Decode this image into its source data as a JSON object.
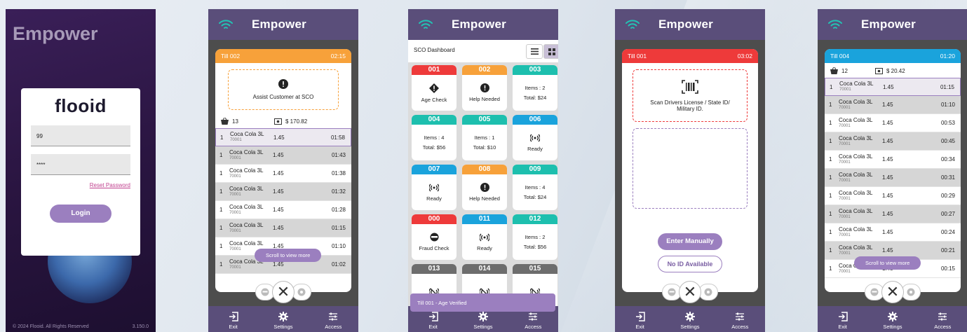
{
  "login": {
    "app_title": "Empower",
    "brand": "flooid",
    "username": "99",
    "password": "****",
    "reset": "Reset Password",
    "login": "Login",
    "copyright": "© 2024 Flooid. All Rights Reserved",
    "version": "3.150.0"
  },
  "app_title": "Empower",
  "nav": {
    "exit": "Exit",
    "settings": "Settings",
    "access": "Access"
  },
  "scroll_more": "Scroll to view more",
  "colors": {
    "purple": "#5a4e7a",
    "orange": "#f7a13a",
    "red": "#ee3a3a",
    "teal": "#1dbfae",
    "blue": "#1aa3dc",
    "gray": "#6d6d6d",
    "accent": "#9b7fbf"
  },
  "s2": {
    "till": "Till 002",
    "time": "02:15",
    "alert": "Assist Customer at SCO",
    "items": "13",
    "amount": "$ 170.82",
    "rows": [
      {
        "q": "1",
        "name": "Coca Cola 3L",
        "code": "70001",
        "price": "1.45",
        "time": "01:58"
      },
      {
        "q": "1",
        "name": "Coca Cola 3L",
        "code": "70001",
        "price": "1.45",
        "time": "01:43"
      },
      {
        "q": "1",
        "name": "Coca Cola 3L",
        "code": "70001",
        "price": "1.45",
        "time": "01:38"
      },
      {
        "q": "1",
        "name": "Coca Cola 3L",
        "code": "70001",
        "price": "1.45",
        "time": "01:32"
      },
      {
        "q": "1",
        "name": "Coca Cola 3L",
        "code": "70001",
        "price": "1.45",
        "time": "01:28"
      },
      {
        "q": "1",
        "name": "Coca Cola 3L",
        "code": "70001",
        "price": "1.45",
        "time": "01:15"
      },
      {
        "q": "1",
        "name": "Coca Cola 3L",
        "code": "70001",
        "price": "1.45",
        "time": "01:10"
      },
      {
        "q": "1",
        "name": "Coca Cola 3L",
        "code": "70001",
        "price": "1.45",
        "time": "01:02"
      }
    ]
  },
  "s3": {
    "title": "SCO Dashboard",
    "banner": "Till 001  - Age Verified",
    "tiles": [
      {
        "id": "001",
        "color": "red",
        "l1": "Age Check",
        "l2": "",
        "icon": "age"
      },
      {
        "id": "002",
        "color": "orange",
        "l1": "Help Needed",
        "l2": "",
        "icon": "alert"
      },
      {
        "id": "003",
        "color": "teal",
        "l1": "Items : 2",
        "l2": "Total: $24",
        "icon": ""
      },
      {
        "id": "004",
        "color": "teal",
        "l1": "Items : 4",
        "l2": "Total: $56",
        "icon": ""
      },
      {
        "id": "005",
        "color": "teal",
        "l1": "Items : 1",
        "l2": "Total: $10",
        "icon": ""
      },
      {
        "id": "006",
        "color": "blue",
        "l1": "Ready",
        "l2": "",
        "icon": "signal"
      },
      {
        "id": "007",
        "color": "blue",
        "l1": "Ready",
        "l2": "",
        "icon": "signal"
      },
      {
        "id": "008",
        "color": "orange",
        "l1": "Help Needed",
        "l2": "",
        "icon": "alert"
      },
      {
        "id": "009",
        "color": "teal",
        "l1": "Items : 4",
        "l2": "Total: $24",
        "icon": ""
      },
      {
        "id": "000",
        "color": "red",
        "l1": "Fraud Check",
        "l2": "",
        "icon": "mask"
      },
      {
        "id": "011",
        "color": "blue",
        "l1": "Ready",
        "l2": "",
        "icon": "signal"
      },
      {
        "id": "012",
        "color": "teal",
        "l1": "Items : 2",
        "l2": "Total: $56",
        "icon": ""
      },
      {
        "id": "013",
        "color": "gray",
        "l1": "",
        "l2": "",
        "icon": "nosignal"
      },
      {
        "id": "014",
        "color": "gray",
        "l1": "",
        "l2": "",
        "icon": "nosignal"
      },
      {
        "id": "015",
        "color": "gray",
        "l1": "",
        "l2": "",
        "icon": "nosignal"
      }
    ]
  },
  "s4": {
    "till": "Till 001",
    "time": "03:02",
    "scan": "Scan Drivers License / State ID/ Military ID.",
    "enter": "Enter Manually",
    "noid": "No ID Available"
  },
  "s5": {
    "till": "Till 004",
    "time": "01:20",
    "items": "12",
    "amount": "$ 20.42",
    "rows": [
      {
        "q": "1",
        "name": "Coca Cola 3L",
        "code": "70001",
        "price": "1.45",
        "time": "01:15"
      },
      {
        "q": "1",
        "name": "Coca Cola 3L",
        "code": "70001",
        "price": "1.45",
        "time": "01:10"
      },
      {
        "q": "1",
        "name": "Coca Cola 3L",
        "code": "70001",
        "price": "1.45",
        "time": "00:53"
      },
      {
        "q": "1",
        "name": "Coca Cola 3L",
        "code": "70001",
        "price": "1.45",
        "time": "00:45"
      },
      {
        "q": "1",
        "name": "Coca Cola 3L",
        "code": "70001",
        "price": "1.45",
        "time": "00:34"
      },
      {
        "q": "1",
        "name": "Coca Cola 3L",
        "code": "70001",
        "price": "1.45",
        "time": "00:31"
      },
      {
        "q": "1",
        "name": "Coca Cola 3L",
        "code": "70001",
        "price": "1.45",
        "time": "00:29"
      },
      {
        "q": "1",
        "name": "Coca Cola 3L",
        "code": "70001",
        "price": "1.45",
        "time": "00:27"
      },
      {
        "q": "1",
        "name": "Coca Cola 3L",
        "code": "70001",
        "price": "1.45",
        "time": "00:24"
      },
      {
        "q": "1",
        "name": "Coca Cola 3L",
        "code": "70001",
        "price": "1.45",
        "time": "00:21"
      },
      {
        "q": "1",
        "name": "Coca Cola 3L",
        "code": "70001",
        "price": "1.45",
        "time": "00:15"
      }
    ]
  }
}
